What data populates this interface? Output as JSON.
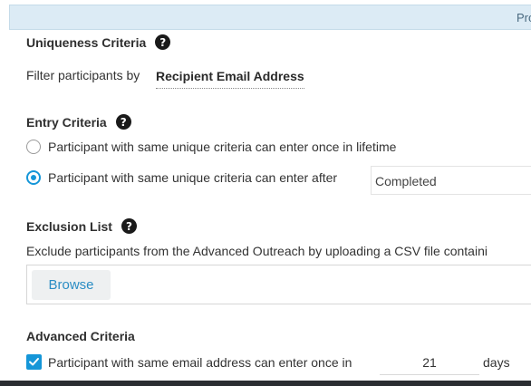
{
  "topbar": {
    "crumb": "Pro"
  },
  "uniqueness": {
    "title": "Uniqueness Criteria",
    "filter_label": "Filter participants by",
    "filter_value": "Recipient Email Address"
  },
  "entry": {
    "title": "Entry Criteria",
    "option_once": "Participant with same unique criteria can enter once in lifetime",
    "option_after": "Participant with same unique criteria can enter after",
    "after_value": "Completed",
    "selected": "after"
  },
  "exclusion": {
    "title": "Exclusion List",
    "description": "Exclude participants from the Advanced Outreach by uploading a CSV file containi",
    "browse_label": "Browse"
  },
  "advanced": {
    "title": "Advanced Criteria",
    "checkbox_label": "Participant with same email address can enter once in",
    "days_value": "21",
    "days_label": "days",
    "checked": true
  },
  "icons": {
    "help": "question-circle-icon",
    "check": "checkmark-icon"
  },
  "colors": {
    "accent": "#1596d8",
    "topbar_bg": "#dcebf5",
    "link": "#2b8dc4"
  }
}
